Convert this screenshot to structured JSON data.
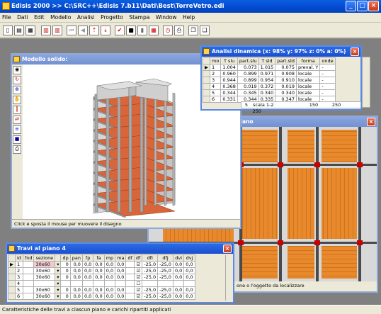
{
  "app": {
    "title": "Edisis 2000 >> C:\\SRC++\\Edisis 7.b11\\Dati\\Best\\TorreVetro.edi",
    "menu": [
      "File",
      "Dati",
      "Edit",
      "Modello",
      "Analisi",
      "Progetto",
      "Stampa",
      "Window",
      "Help"
    ],
    "status": "Caratteristiche delle travi a ciascun piano e carichi ripartiti applicati"
  },
  "solid": {
    "title": "Modello solido:",
    "hint": "Click e sposta il mouse per muovere il disegno"
  },
  "dyn": {
    "title": "Analisi dinamica (x: 98% y: 97% z:  0% a:  0%)",
    "columns": [
      "mo",
      "T slu",
      "part.slu",
      "T sld",
      "part.sld",
      "forma",
      "onde"
    ],
    "rows": [
      [
        "1",
        "1.004",
        "0.073",
        "1.015",
        "0.075",
        "preval. Y",
        "-"
      ],
      [
        "2",
        "0.960",
        "0.899",
        "0.971",
        "0.908",
        "locale",
        "-"
      ],
      [
        "3",
        "0.944",
        "0.899",
        "0.954",
        "0.910",
        "locale",
        "-"
      ],
      [
        "4",
        "0.368",
        "0.019",
        "0.372",
        "0.019",
        "locale",
        "-"
      ],
      [
        "5",
        "0.344",
        "0.345",
        "0.340",
        "0.340",
        "locale",
        "-"
      ],
      [
        "6",
        "0.331",
        "0.344",
        "0.335",
        "0.347",
        "locale",
        "-"
      ]
    ],
    "under_row": [
      "5",
      "scala 1-2",
      "150",
      "250",
      "250"
    ]
  },
  "plan": {
    "title": "piano",
    "hint": "one o l'oggetto da localizzare"
  },
  "travi": {
    "title": "Travi al piano 4",
    "columns": [
      "id",
      "fnd",
      "sezione",
      "",
      "dp",
      "pan",
      "fp",
      "fa",
      "mp",
      "ma",
      "df",
      "df",
      "dfi",
      "dfj",
      "dvi",
      "dvj"
    ],
    "rows": [
      [
        "1",
        "",
        "30x60",
        "",
        "0",
        "0,0",
        "0,0",
        "0,0",
        "0,0",
        "0,0",
        "",
        "☑",
        "-25,0",
        "-25,0",
        "0,0",
        "0,0"
      ],
      [
        "2",
        "",
        "30x60",
        "",
        "0",
        "0,0",
        "0,0",
        "0,0",
        "0,0",
        "0,0",
        "",
        "☑",
        "-25,0",
        "-25,0",
        "0,0",
        "0,0"
      ],
      [
        "3",
        "",
        "30x60",
        "",
        "0",
        "0,0",
        "0,0",
        "0,0",
        "0,0",
        "0,0",
        "",
        "☑",
        "-25,0",
        "-25,0",
        "0,0",
        "0,0"
      ],
      [
        "4",
        "",
        "",
        "",
        "",
        "",
        "",
        "",
        "",
        "",
        "",
        "☐",
        "",
        "",
        "",
        ""
      ],
      [
        "5",
        "",
        "30x60",
        "",
        "0",
        "0,0",
        "0,0",
        "0,0",
        "0,0",
        "0,0",
        "",
        "☑",
        "-25,0",
        "-25,0",
        "0,0",
        "0,0"
      ],
      [
        "6",
        "",
        "30x60",
        "",
        "0",
        "0,0",
        "0,0",
        "0,0",
        "0,0",
        "0,0",
        "",
        "☑",
        "-25,0",
        "-25,0",
        "0,0",
        "0,0"
      ]
    ]
  }
}
